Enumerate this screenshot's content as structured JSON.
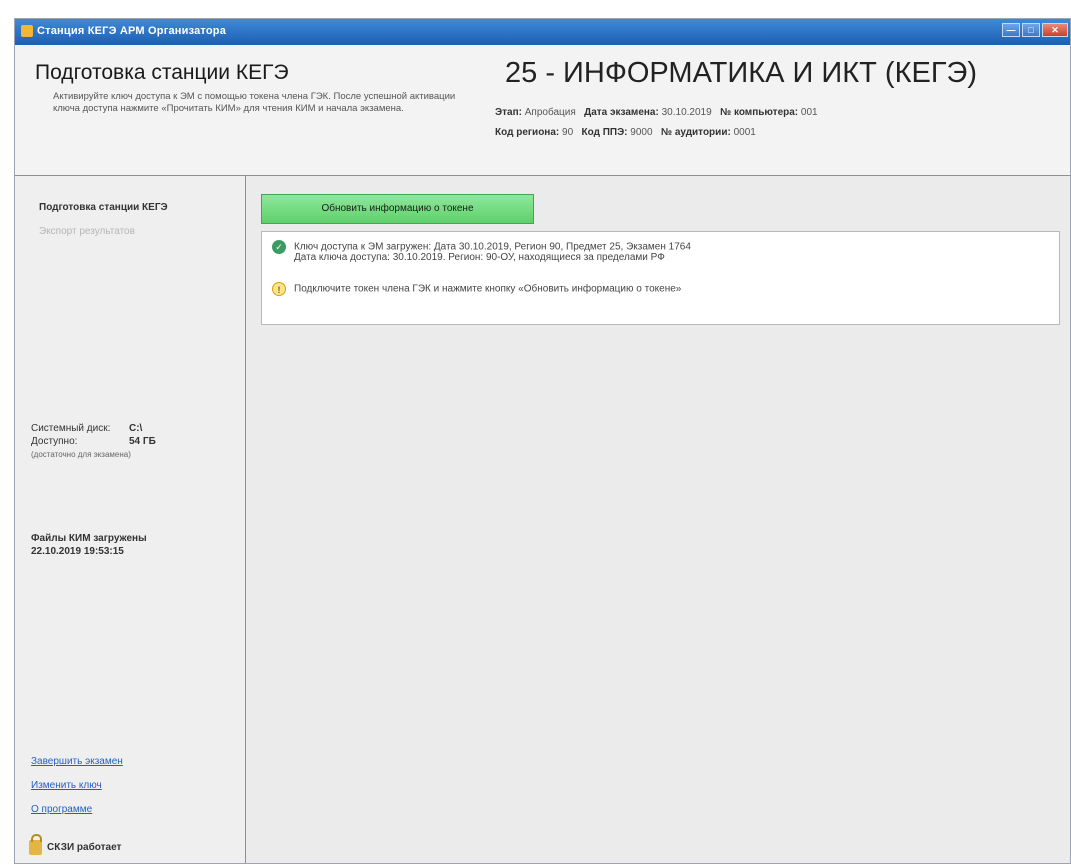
{
  "window": {
    "title": "Станция КЕГЭ АРМ Организатора"
  },
  "header": {
    "page_title": "Подготовка станции КЕГЭ",
    "description": "Активируйте ключ доступа к ЭМ с помощью токена члена ГЭК. После успешной активации ключа доступа нажмите «Прочитать КИМ» для чтения КИМ и начала экзамена.",
    "exam_title": "25 - ИНФОРМАТИКА И ИКТ (КЕГЭ)",
    "meta": {
      "stage_label": "Этап:",
      "stage_value": "Апробация",
      "date_label": "Дата экзамена:",
      "date_value": "30.10.2019",
      "computer_label": "№ компьютера:",
      "computer_value": "001",
      "region_label": "Код региона:",
      "region_value": "90",
      "ppe_label": "Код ППЭ:",
      "ppe_value": "9000",
      "aud_label": "№ аудитории:",
      "aud_value": "0001"
    }
  },
  "sidebar": {
    "nav_prep": "Подготовка станции КЕГЭ",
    "nav_export": "Экспорт результатов",
    "disk": {
      "system_disk_label": "Системный диск:",
      "system_disk_value": "C:\\",
      "available_label": "Доступно:",
      "available_value": "54 ГБ",
      "note": "(достаточно для экзамена)"
    },
    "files_loaded_label": "Файлы КИМ загружены",
    "files_loaded_time": "22.10.2019 19:53:15",
    "links": {
      "finish_exam": "Завершить экзамен",
      "change_key": "Изменить ключ",
      "about": "О программе"
    },
    "status": "СКЗИ работает"
  },
  "main": {
    "refresh_button": "Обновить информацию о токене",
    "info": {
      "line1": "Ключ доступа к ЭМ загружен: Дата 30.10.2019, Регион 90, Предмет 25, Экзамен 1764",
      "line2": "Дата ключа доступа: 30.10.2019. Регион: 90-ОУ, находящиеся за пределами РФ",
      "line3": "Подключите токен члена ГЭК и нажмите кнопку «Обновить информацию о токене»"
    }
  }
}
